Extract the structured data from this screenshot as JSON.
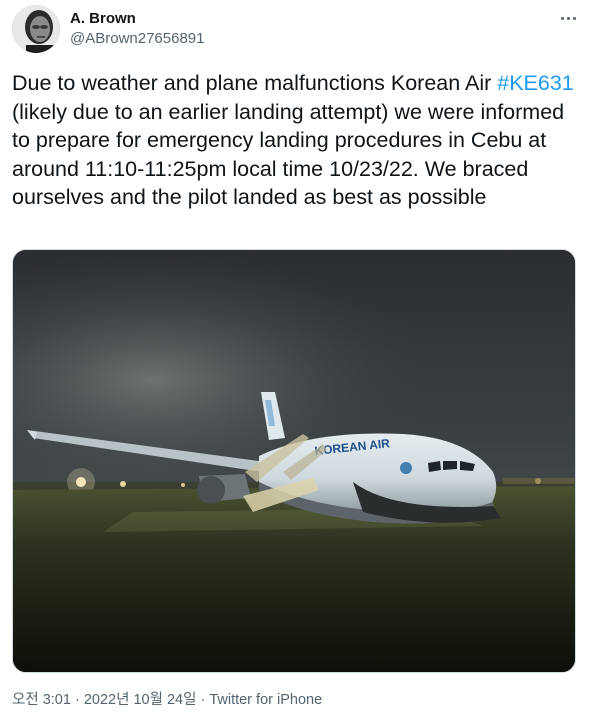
{
  "author": {
    "name": "A. Brown",
    "handle": "@ABrown27656891"
  },
  "tweet": {
    "text_before": "Due to weather and plane malfunctions Korean Air ",
    "hashtag": "#KE631",
    "text_after": " (likely due to an earlier landing attempt) we were informed to prepare for emergency landing procedures in Cebu at around 11:10-11:25pm local time 10/23/22. We braced ourselves and the pilot landed as best as possible"
  },
  "media": {
    "fuselage_lettering": "KOREAN AIR"
  },
  "meta": {
    "time": "오전 3:01",
    "separator1": " · ",
    "date": "2022년 10월 24일",
    "separator2": " · ",
    "source": "Twitter for iPhone"
  },
  "colors": {
    "accent": "#1d9bf0",
    "text_primary": "#0f1419",
    "text_secondary": "#536471"
  }
}
